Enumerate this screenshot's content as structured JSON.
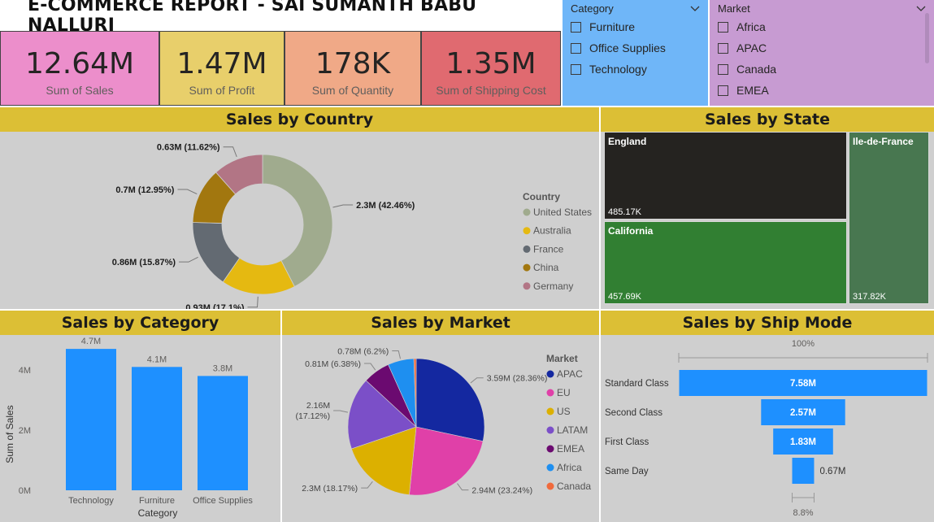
{
  "title": "E-COMMERCE REPORT - SAI SUMANTH BABU NALLURI",
  "kpis": [
    {
      "value": "12.64M",
      "label": "Sum of Sales",
      "color": "#ec8ecb"
    },
    {
      "value": "1.47M",
      "label": "Sum of Profit",
      "color": "#e8cf6b"
    },
    {
      "value": "178K",
      "label": "Sum of Quantity",
      "color": "#f0a987"
    },
    {
      "value": "1.35M",
      "label": "Sum of Shipping Cost",
      "color": "#e06a70"
    }
  ],
  "slicers": {
    "category": {
      "title": "Category",
      "items": [
        "Furniture",
        "Office Supplies",
        "Technology"
      ],
      "bg": "#6fb6f8"
    },
    "market": {
      "title": "Market",
      "items": [
        "Africa",
        "APAC",
        "Canada",
        "EMEA"
      ],
      "bg": "#c79bd2"
    }
  },
  "panels": {
    "country": "Sales by Country",
    "state": "Sales by State",
    "category": "Sales by Category",
    "market": "Sales by Market",
    "shipmode": "Sales by Ship Mode"
  },
  "chart_data": [
    {
      "id": "country",
      "type": "pie",
      "donut": true,
      "title": "Sales by Country",
      "legend_title": "Country",
      "legend_position": "right",
      "slices": [
        {
          "name": "United States",
          "value": 2.3,
          "label": "2.3M (42.46%)",
          "color": "#a0ab8e"
        },
        {
          "name": "Australia",
          "value": 0.93,
          "label": "0.93M (17.1%)",
          "color": "#e5b911"
        },
        {
          "name": "France",
          "value": 0.86,
          "label": "0.86M (15.87%)",
          "color": "#636a72"
        },
        {
          "name": "China",
          "value": 0.7,
          "label": "0.7M (12.95%)",
          "color": "#a2770f"
        },
        {
          "name": "Germany",
          "value": 0.63,
          "label": "0.63M (11.62%)",
          "color": "#b27585"
        }
      ]
    },
    {
      "id": "state",
      "type": "treemap",
      "title": "Sales by State",
      "items": [
        {
          "name": "England",
          "value": 485.17,
          "label": "485.17K",
          "color": "#252320"
        },
        {
          "name": "California",
          "value": 457.69,
          "label": "457.69K",
          "color": "#317f32"
        },
        {
          "name": "Ile-de-France",
          "value": 317.82,
          "label": "317.82K",
          "color": "#487750"
        }
      ]
    },
    {
      "id": "category",
      "type": "bar",
      "title": "Sales by Category",
      "categories": [
        "Technology",
        "Furniture",
        "Office Supplies"
      ],
      "values": [
        4.7,
        4.1,
        3.8
      ],
      "labels": [
        "4.7M",
        "4.1M",
        "3.8M"
      ],
      "xlabel": "Category",
      "ylabel": "Sum of Sales",
      "yticks": [
        "0M",
        "2M",
        "4M"
      ],
      "ylim": [
        0,
        5
      ],
      "color": "#1e90ff"
    },
    {
      "id": "market",
      "type": "pie",
      "donut": false,
      "title": "Sales by Market",
      "legend_title": "Market",
      "legend_position": "right",
      "slices": [
        {
          "name": "APAC",
          "value": 3.59,
          "label": "3.59M (28.36%)",
          "color": "#1428a0"
        },
        {
          "name": "EU",
          "value": 2.94,
          "label": "2.94M (23.24%)",
          "color": "#e040a8"
        },
        {
          "name": "US",
          "value": 2.3,
          "label": "2.3M (18.17%)",
          "color": "#dcb000"
        },
        {
          "name": "LATAM",
          "value": 2.16,
          "label": "2.16M (17.12%)",
          "color": "#7b4fc8"
        },
        {
          "name": "EMEA",
          "value": 0.81,
          "label": "0.81M (6.38%)",
          "color": "#6b0a70"
        },
        {
          "name": "Africa",
          "value": 0.78,
          "label": "0.78M (6.2%)",
          "color": "#1e8ff0"
        },
        {
          "name": "Canada",
          "value": 0.07,
          "label": "",
          "color": "#f06a3c"
        }
      ]
    },
    {
      "id": "shipmode",
      "type": "funnel",
      "title": "Sales by Ship Mode",
      "top_label": "100%",
      "bottom_label": "8.8%",
      "stages": [
        {
          "name": "Standard Class",
          "value": 7.58,
          "label": "7.58M"
        },
        {
          "name": "Second Class",
          "value": 2.57,
          "label": "2.57M"
        },
        {
          "name": "First Class",
          "value": 1.83,
          "label": "1.83M"
        },
        {
          "name": "Same Day",
          "value": 0.67,
          "label": "0.67M"
        }
      ],
      "color": "#1e90ff"
    }
  ]
}
